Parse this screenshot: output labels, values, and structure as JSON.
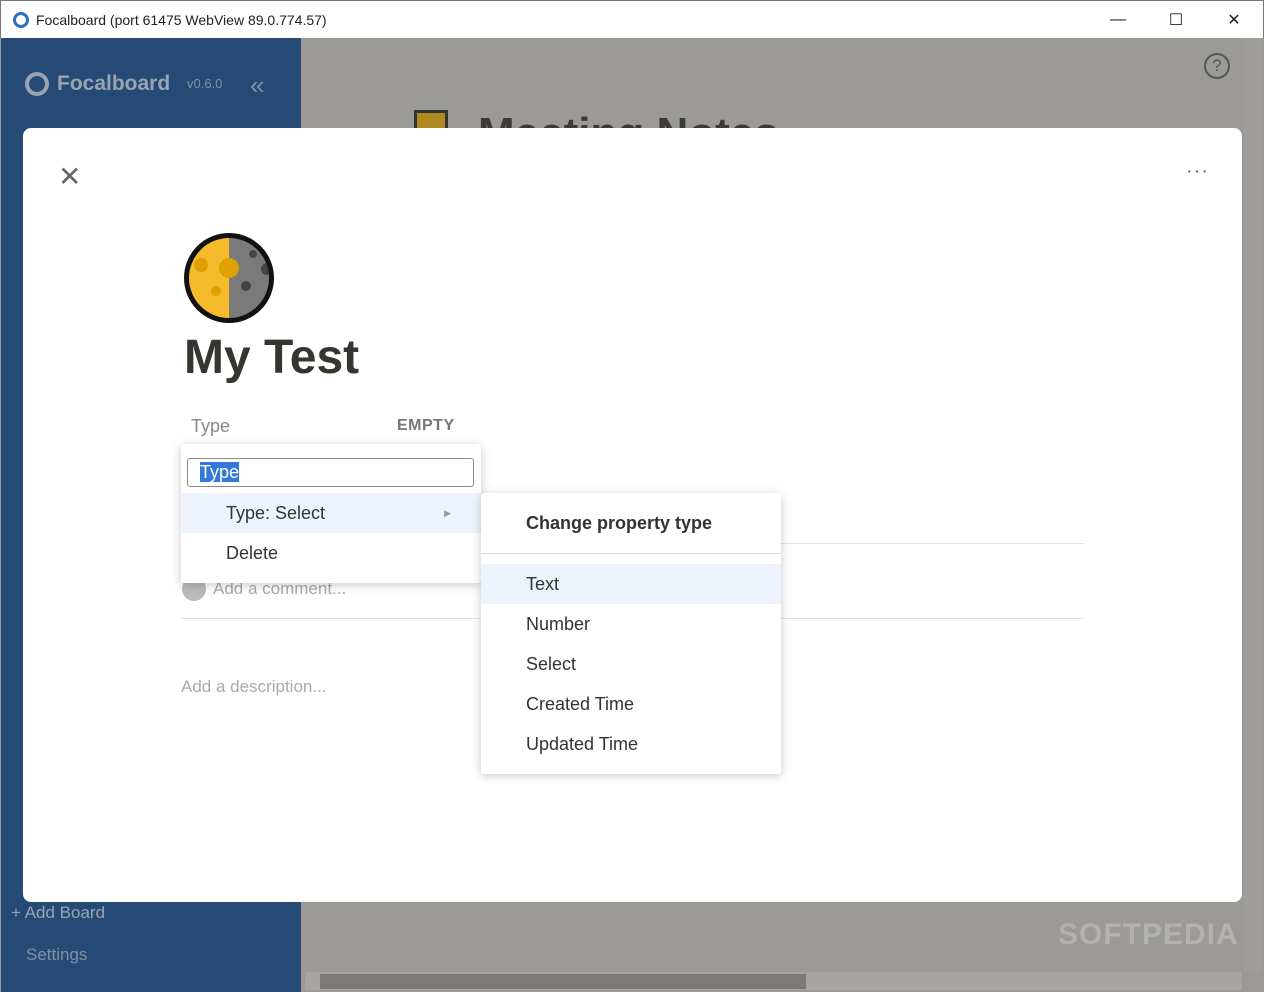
{
  "window": {
    "title": "Focalboard (port 61475 WebView 89.0.774.57)",
    "minimize": "—",
    "maximize": "☐",
    "close": "✕"
  },
  "sidebar": {
    "brand": "Focalboard",
    "version": "v0.6.0",
    "collapse": "«",
    "add_board": "+ Add Board",
    "settings": "Settings"
  },
  "background": {
    "board_title": "Meeting Notes",
    "help": "?",
    "watermark": "SOFTPEDIA"
  },
  "card": {
    "close": "✕",
    "more": "···",
    "title": "My Test",
    "property": {
      "name": "Type",
      "value": "EMPTY"
    },
    "comment_placeholder": "Add a comment...",
    "description_placeholder": "Add a description..."
  },
  "property_menu": {
    "name_input": "Type",
    "items": [
      "Type: Select",
      "Delete"
    ]
  },
  "type_menu": {
    "heading": "Change property type",
    "items": [
      "Text",
      "Number",
      "Select",
      "Created Time",
      "Updated Time"
    ]
  }
}
